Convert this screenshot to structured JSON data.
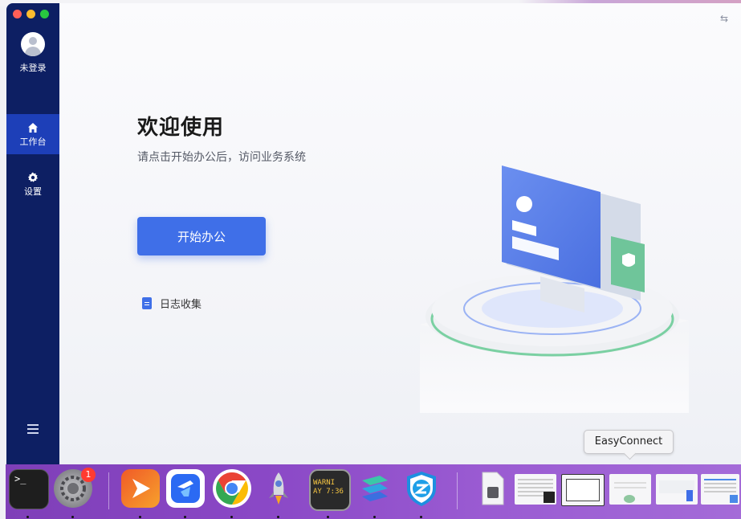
{
  "sidebar": {
    "login_label": "未登录",
    "items": [
      {
        "label": "工作台",
        "icon": "home-icon",
        "active": true
      },
      {
        "label": "设置",
        "icon": "gear-icon",
        "active": false
      }
    ]
  },
  "main": {
    "title": "欢迎使用",
    "subtitle": "请点击开始办公后，访问业务系统",
    "start_button": "开始办公",
    "log_link": "日志收集"
  },
  "dock": {
    "tooltip": "EasyConnect",
    "settings_badge": "1",
    "terminal_prompt": ">_",
    "console_text": "WARNI\nAY 7:36",
    "apps": [
      "terminal-icon",
      "system-settings-icon",
      "presentation-app-icon",
      "feishu-icon",
      "chrome-icon",
      "rocket-icon",
      "console-icon",
      "stacks-icon",
      "easyconnect-icon"
    ]
  },
  "colors": {
    "sidebar_bg": "#0d1f63",
    "sidebar_active": "#1d3fb8",
    "accent": "#3f6fe8",
    "dock_bg": "#8a48c6"
  }
}
